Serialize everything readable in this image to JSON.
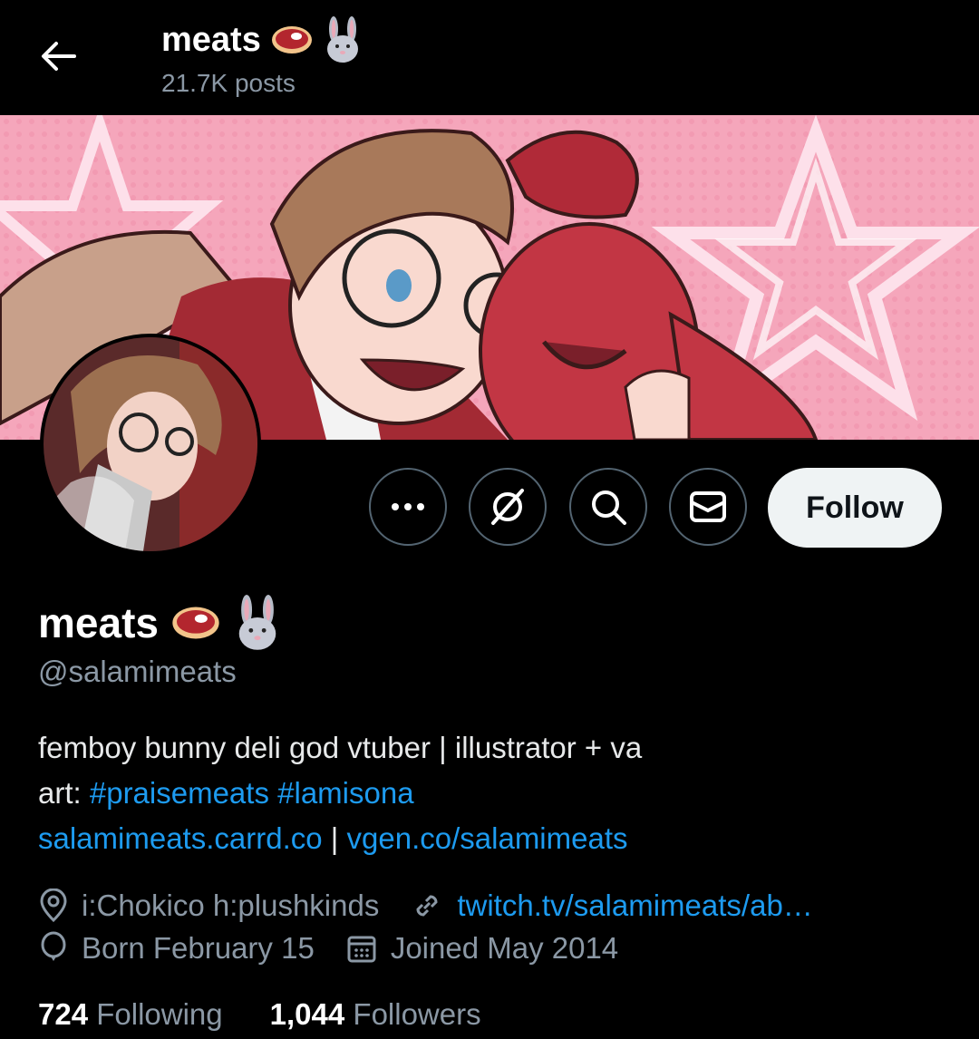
{
  "header": {
    "title": "meats",
    "posts": "21.7K posts"
  },
  "profile": {
    "display_name": "meats",
    "handle": "@salamimeats"
  },
  "actions": {
    "follow_label": "Follow",
    "more_icon": "more-icon",
    "grok_icon": "grok-icon",
    "search_icon": "search-icon",
    "message_icon": "mail-icon"
  },
  "bio": {
    "line1": "femboy bunny deli god vtuber | illustrator + va",
    "line2_prefix": "art: ",
    "hashtag1": "#praisemeats",
    "hashtag2": "#lamisona",
    "link1": "salamimeats.carrd.co",
    "separator": " | ",
    "link2": "vgen.co/salamimeats"
  },
  "meta": {
    "location": "i:Chokico h:plushkinds",
    "website": "twitch.tv/salamimeats/ab…",
    "birthday": "Born February 15",
    "joined": "Joined May 2014"
  },
  "stats": {
    "following_count": "724",
    "following_label": "Following",
    "followers_count": "1,044",
    "followers_label": "Followers"
  },
  "colors": {
    "background": "#000000",
    "link": "#1d9bf0",
    "secondary_text": "#8b98a5",
    "banner_pink": "#f4a3b8",
    "follow_button_bg": "#eff3f4"
  }
}
